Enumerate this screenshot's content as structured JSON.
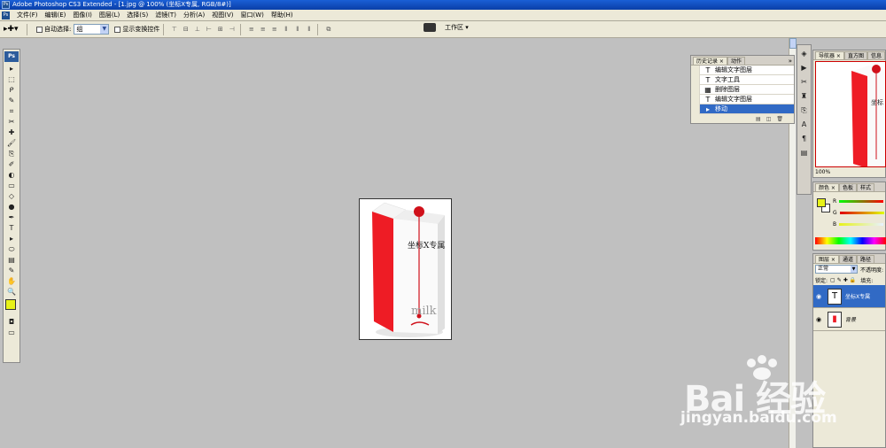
{
  "titlebar": {
    "title": "Adobe Photoshop CS3 Extended - [1.jpg @ 100% (坐标X专属, RGB/8#)]",
    "icon": "Ps"
  },
  "menubar": {
    "ps_icon": "Ps",
    "items": [
      "文件(F)",
      "编辑(E)",
      "图像(I)",
      "图层(L)",
      "选择(S)",
      "滤镜(T)",
      "分析(A)",
      "视图(V)",
      "窗口(W)",
      "帮助(H)"
    ]
  },
  "options": {
    "auto_select_label": "自动选择:",
    "auto_select_value": "组",
    "show_transform_label": "显示变换控件",
    "workspace_label": "工作区 ▾"
  },
  "toolbox": {
    "logo": "Ps",
    "tools": [
      "▸",
      "⬚",
      "ᑭ",
      "✎",
      "⌗",
      "✂",
      "✚",
      "🖌",
      "⎘",
      "✐",
      "◐",
      "▭",
      "◇",
      "●",
      "✒",
      "T",
      "▸",
      "⬭",
      "▤",
      "✎",
      "✋",
      "🔍"
    ],
    "fg_color": "#e7f218"
  },
  "history": {
    "tabs": [
      "历史记录 ×",
      "动作"
    ],
    "items": [
      {
        "icon": "T",
        "label": "编辑文字图层"
      },
      {
        "icon": "T",
        "label": "文字工具"
      },
      {
        "icon": "▦",
        "label": "删除图层"
      },
      {
        "icon": "T",
        "label": "编辑文字图层"
      },
      {
        "icon": "▸",
        "label": "移动"
      }
    ],
    "selected_index": 4,
    "footer_icons": [
      "▤",
      "◫",
      "🗑"
    ]
  },
  "document": {
    "overlay_text": "坐标X专属",
    "product_text": "milk"
  },
  "navigator": {
    "tabs": [
      "导航器 ×",
      "直方图",
      "信息"
    ],
    "zoom": "100%",
    "preview_text": "坐标"
  },
  "color_panel": {
    "tabs": [
      "颜色 ×",
      "色板",
      "样式"
    ],
    "channels": [
      "R",
      "G",
      "B"
    ]
  },
  "layers": {
    "tabs": [
      "图层 ×",
      "通道",
      "路径"
    ],
    "blend_mode": "正常",
    "opacity_label": "不透明度:",
    "lock_label": "锁定:",
    "fill_label": "填充:",
    "items": [
      {
        "name": "坐标X专属",
        "thumb": "T",
        "selected": true
      },
      {
        "name": "背景",
        "thumb": "▮",
        "selected": false
      }
    ]
  },
  "watermark": {
    "logo": "Bai 经验",
    "url": "jingyan.baidu.com"
  },
  "colors": {
    "accent": "#316ac5",
    "milk_red": "#ee1c25",
    "titlebar": "#0a3fa8"
  }
}
